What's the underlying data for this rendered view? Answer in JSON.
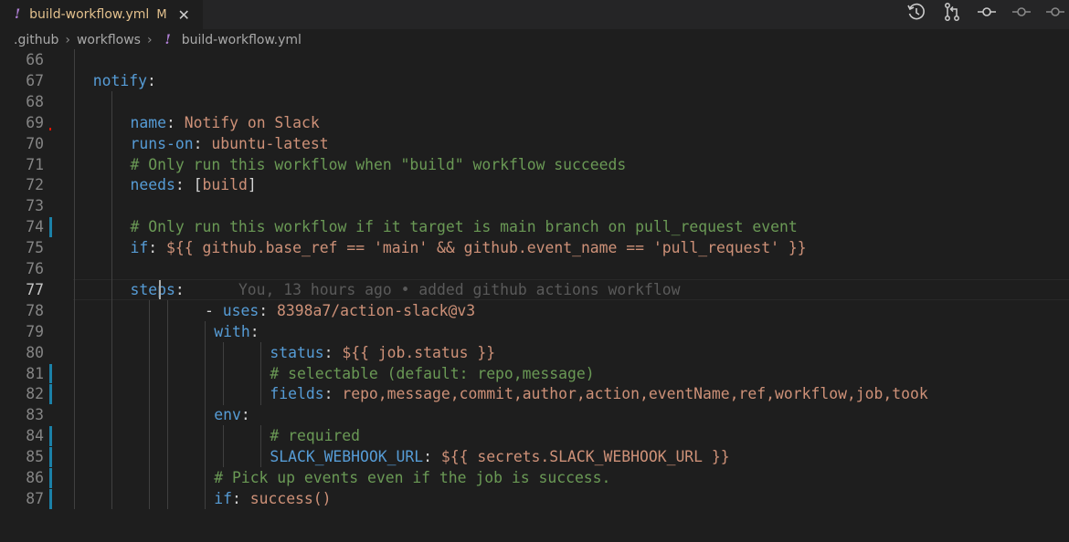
{
  "tab": {
    "icon": "!",
    "filename": "build-workflow.yml",
    "modified": "M",
    "close": "✕"
  },
  "toolbar_icons": [
    "timeline-icon",
    "compare-changes-icon",
    "git-commit-icon",
    "previous-change-icon",
    "next-change-icon"
  ],
  "breadcrumb": {
    "parts": [
      ".github",
      "workflows"
    ],
    "file_icon": "!",
    "file": "build-workflow.yml"
  },
  "blame": "You, 13 hours ago • added github actions workflow",
  "colors": {
    "key": "#569cd6",
    "string": "#ce9178",
    "comment": "#6a9955",
    "gutter_modified": "#1b81a8"
  },
  "lines": [
    {
      "n": "66",
      "text": ""
    },
    {
      "n": "67",
      "text": "notify:"
    },
    {
      "n": "68",
      "text": ""
    },
    {
      "n": "69",
      "text": "name: Notify on Slack"
    },
    {
      "n": "70",
      "text": "runs-on: ubuntu-latest"
    },
    {
      "n": "71",
      "text": "# Only run this workflow when \"build\" workflow succeeds"
    },
    {
      "n": "72",
      "text": "needs: [build]"
    },
    {
      "n": "73",
      "text": ""
    },
    {
      "n": "74",
      "text": "# Only run this workflow if it target is main branch on pull_request event"
    },
    {
      "n": "75",
      "text": "if: ${{ github.base_ref == 'main' && github.event_name == 'pull_request' }}"
    },
    {
      "n": "76",
      "text": ""
    },
    {
      "n": "77",
      "text": "steps:"
    },
    {
      "n": "78",
      "text": "- uses: 8398a7/action-slack@v3"
    },
    {
      "n": "79",
      "text": "with:"
    },
    {
      "n": "80",
      "text": "status: ${{ job.status }}"
    },
    {
      "n": "81",
      "text": "# selectable (default: repo,message)"
    },
    {
      "n": "82",
      "text": "fields: repo,message,commit,author,action,eventName,ref,workflow,job,took"
    },
    {
      "n": "83",
      "text": "env:"
    },
    {
      "n": "84",
      "text": "# required"
    },
    {
      "n": "85",
      "text": "SLACK_WEBHOOK_URL: ${{ secrets.SLACK_WEBHOOK_URL }}"
    },
    {
      "n": "86",
      "text": "# Pick up events even if the job is success."
    },
    {
      "n": "87",
      "text": "if: success()"
    }
  ]
}
